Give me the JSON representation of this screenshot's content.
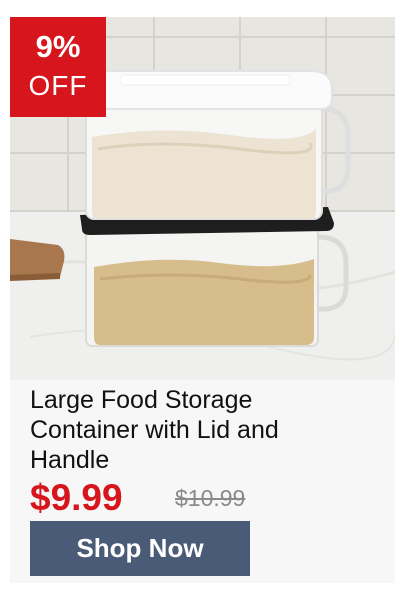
{
  "badge": {
    "percent": "9%",
    "off": "OFF"
  },
  "product": {
    "title": "Large Food Storage Container with Lid and Handle",
    "price": "$9.99",
    "original_price": "$10.99",
    "image": "food-storage-container-photo"
  },
  "cta": {
    "label": "Shop Now"
  },
  "colors": {
    "badge": "#d6161c",
    "price": "#d6161c",
    "button": "#4a5b78",
    "old_price": "#8a8a8a"
  }
}
